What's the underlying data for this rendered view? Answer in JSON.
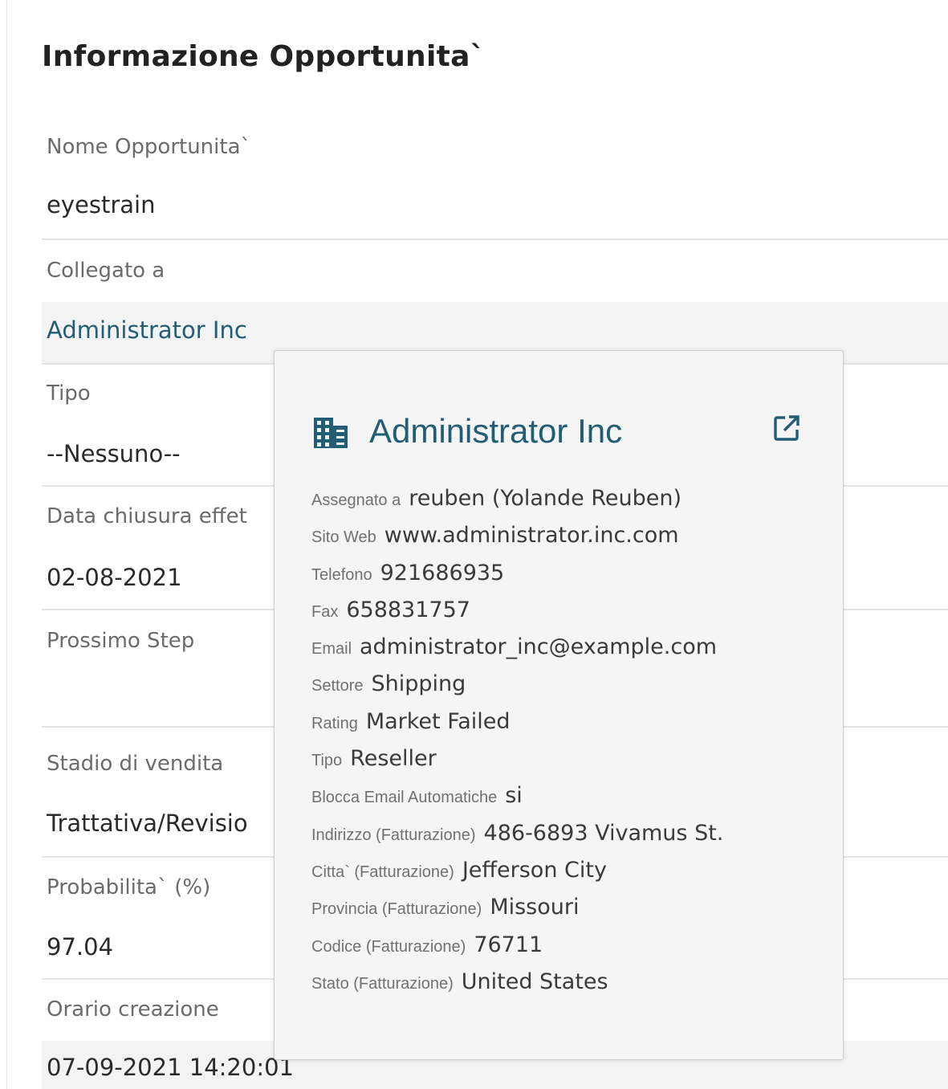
{
  "page": {
    "title": "Informazione Opportunita`"
  },
  "fields": [
    {
      "label": "Nome Opportunita`",
      "value": "eyestrain"
    },
    {
      "label": "Collegato a",
      "value": "Administrator Inc"
    },
    {
      "label": "Tipo",
      "value": "--Nessuno--"
    },
    {
      "label": "Data chiusura effet",
      "value": "02-08-2021"
    },
    {
      "label": "Prossimo Step",
      "value": ""
    },
    {
      "label": "Stadio di vendita",
      "value": "Trattativa/Revisio"
    },
    {
      "label": "Probabilita` (%)",
      "value": "97.04"
    },
    {
      "label": "Orario creazione",
      "value": "07-09-2021 14:20:01"
    }
  ],
  "popover": {
    "title": "Administrator Inc",
    "icons": {
      "entity": "building-icon",
      "open": "external-link-icon"
    },
    "rows": [
      {
        "label": "Assegnato a",
        "value": "reuben (Yolande Reuben)"
      },
      {
        "label": "Sito Web",
        "value": "www.administrator.inc.com"
      },
      {
        "label": "Telefono",
        "value": "921686935"
      },
      {
        "label": "Fax",
        "value": "658831757"
      },
      {
        "label": "Email",
        "value": "administrator_inc@example.com"
      },
      {
        "label": "Settore",
        "value": "Shipping"
      },
      {
        "label": "Rating",
        "value": "Market Failed"
      },
      {
        "label": "Tipo",
        "value": "Reseller"
      },
      {
        "label": "Blocca Email Automatiche",
        "value": "si"
      },
      {
        "label": "Indirizzo (Fatturazione)",
        "value": "486-6893 Vivamus St."
      },
      {
        "label": "Citta` (Fatturazione)",
        "value": "Jefferson City"
      },
      {
        "label": "Provincia (Fatturazione)",
        "value": "Missouri"
      },
      {
        "label": "Codice (Fatturazione)",
        "value": "76711"
      },
      {
        "label": "Stato (Fatturazione)",
        "value": "United States"
      }
    ]
  },
  "colors": {
    "link": "#215d75",
    "label": "#6b6b6b",
    "popover_bg": "#f5f5f5"
  }
}
